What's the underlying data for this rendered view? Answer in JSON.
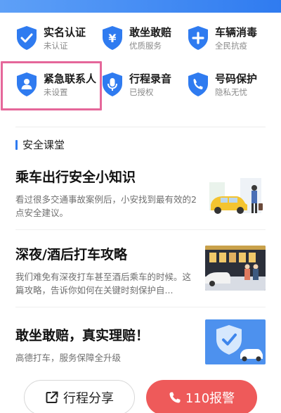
{
  "features": [
    {
      "title": "实名认证",
      "sub": "未认证",
      "icon": "shield-check-icon"
    },
    {
      "title": "敢坐敢赔",
      "sub": "优质服务",
      "icon": "shield-yen-icon"
    },
    {
      "title": "车辆消毒",
      "sub": "全民抗疫",
      "icon": "shield-plus-icon"
    },
    {
      "title": "紧急联系人",
      "sub": "未设置",
      "icon": "shield-person-icon"
    },
    {
      "title": "行程录音",
      "sub": "已授权",
      "icon": "shield-mic-icon"
    },
    {
      "title": "号码保护",
      "sub": "隐私无忧",
      "icon": "shield-phone-icon"
    }
  ],
  "section": {
    "title": "安全课堂"
  },
  "articles": [
    {
      "title": "乘车出行安全小知识",
      "desc": "看过很多交通事故案例后，小安找到最有效的2点安全建议。"
    },
    {
      "title": "深夜/酒后打车攻略",
      "desc": "我们难免有深夜打车甚至酒后乘车的时候。这篇攻略，告诉你如何在关键时刻保护自..."
    },
    {
      "title": "敢坐敢赔，真实理赔！",
      "desc": "高德打车，服务保障全升级"
    }
  ],
  "buttons": {
    "share_label": "行程分享",
    "sos_label": "110报警"
  },
  "colors": {
    "accent": "#2f7bf0",
    "highlight": "#e5679a",
    "sos": "#ee5a5a"
  }
}
